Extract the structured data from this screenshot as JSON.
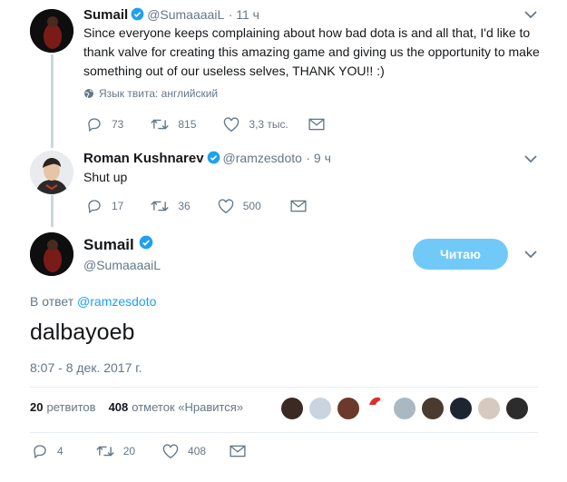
{
  "tweet1": {
    "name": "Sumail",
    "handle": "@SumaaaaiL",
    "time": "· 11 ч",
    "text": "Since everyone keeps complaining about how bad dota is and all that, I'd like to thank valve for creating this amazing game and giving us the opportunity to make something out of our useless selves, THANK YOU!! :)",
    "lang_note": "Язык твита: английский",
    "replies": "73",
    "retweets": "815",
    "likes": "3,3 тыс."
  },
  "tweet2": {
    "name": "Roman Kushnarev",
    "handle": "@ramzesdoto",
    "time": "· 9 ч",
    "text": "Shut up",
    "replies": "17",
    "retweets": "36",
    "likes": "500"
  },
  "main": {
    "name": "Sumail",
    "handle": "@SumaaaaiL",
    "follow_label": "Читаю",
    "reply_prefix": "В ответ",
    "reply_to": "@ramzesdoto",
    "text": "dalbayoeb",
    "timestamp": "8:07 - 8 дек. 2017 г.",
    "retweet_count": "20",
    "retweet_label": "ретвитов",
    "like_count": "408",
    "like_label": "отметок «Нравится»",
    "replies": "4",
    "retweets": "20",
    "likes": "408"
  },
  "colors": {
    "accent": "#1da1f2",
    "follow_bg": "#71c9f8",
    "muted": "#657786",
    "line": "#ccd6dd"
  }
}
